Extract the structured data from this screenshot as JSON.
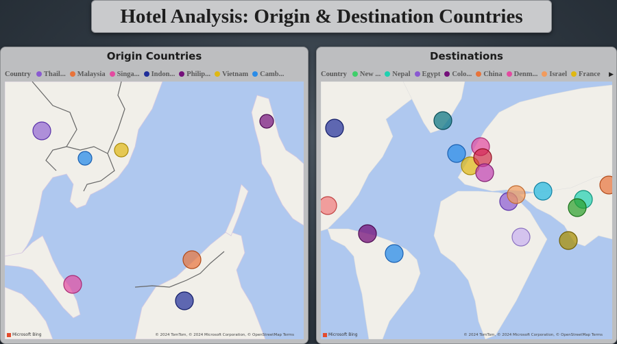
{
  "title": "Hotel Analysis: Origin & Destination Countries",
  "origin": {
    "title": "Origin Countries",
    "legend_label": "Country",
    "legend": [
      {
        "name": "Thail...",
        "color": "#8a5ad1"
      },
      {
        "name": "Malaysia",
        "color": "#e8733a"
      },
      {
        "name": "Singa...",
        "color": "#e34aa0"
      },
      {
        "name": "Indon...",
        "color": "#1f2e99"
      },
      {
        "name": "Philip...",
        "color": "#74107a"
      },
      {
        "name": "Vietnam",
        "color": "#e0b812"
      },
      {
        "name": "Camb...",
        "color": "#2a8ce8"
      }
    ],
    "bing": "Microsoft Bing",
    "attribution": "© 2024 TomTom, © 2024 Microsoft Corporation, © OpenStreetMap  Terms"
  },
  "destinations": {
    "title": "Destinations",
    "legend_label": "Country",
    "legend": [
      {
        "name": "New ...",
        "color": "#3fcf6a"
      },
      {
        "name": "Nepal",
        "color": "#1fd1b0"
      },
      {
        "name": "Egypt",
        "color": "#8a5ad1"
      },
      {
        "name": "Colo...",
        "color": "#74107a"
      },
      {
        "name": "China",
        "color": "#e8733a"
      },
      {
        "name": "Denm...",
        "color": "#e34aa0"
      },
      {
        "name": "Israel",
        "color": "#f29b5c"
      },
      {
        "name": "France",
        "color": "#e0b812"
      }
    ],
    "bing": "Microsoft Bing",
    "attribution": "© 2024 TomTom, © 2024 Microsoft Corporation, © OpenStreetMap  Terms"
  }
}
